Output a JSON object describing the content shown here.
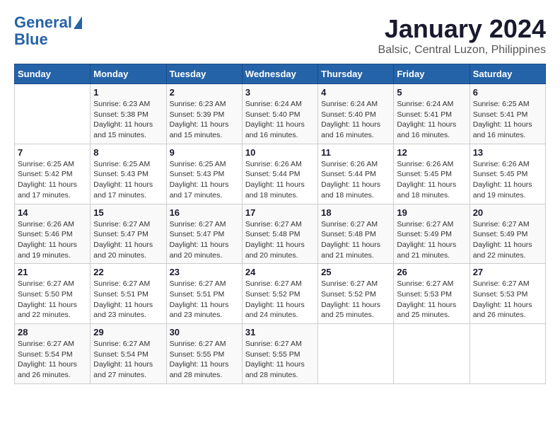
{
  "logo": {
    "line1": "General",
    "line2": "Blue"
  },
  "title": "January 2024",
  "subtitle": "Balsic, Central Luzon, Philippines",
  "weekdays": [
    "Sunday",
    "Monday",
    "Tuesday",
    "Wednesday",
    "Thursday",
    "Friday",
    "Saturday"
  ],
  "weeks": [
    [
      {
        "day": "",
        "info": ""
      },
      {
        "day": "1",
        "info": "Sunrise: 6:23 AM\nSunset: 5:38 PM\nDaylight: 11 hours and 15 minutes."
      },
      {
        "day": "2",
        "info": "Sunrise: 6:23 AM\nSunset: 5:39 PM\nDaylight: 11 hours and 15 minutes."
      },
      {
        "day": "3",
        "info": "Sunrise: 6:24 AM\nSunset: 5:40 PM\nDaylight: 11 hours and 16 minutes."
      },
      {
        "day": "4",
        "info": "Sunrise: 6:24 AM\nSunset: 5:40 PM\nDaylight: 11 hours and 16 minutes."
      },
      {
        "day": "5",
        "info": "Sunrise: 6:24 AM\nSunset: 5:41 PM\nDaylight: 11 hours and 16 minutes."
      },
      {
        "day": "6",
        "info": "Sunrise: 6:25 AM\nSunset: 5:41 PM\nDaylight: 11 hours and 16 minutes."
      }
    ],
    [
      {
        "day": "7",
        "info": "Sunrise: 6:25 AM\nSunset: 5:42 PM\nDaylight: 11 hours and 17 minutes."
      },
      {
        "day": "8",
        "info": "Sunrise: 6:25 AM\nSunset: 5:43 PM\nDaylight: 11 hours and 17 minutes."
      },
      {
        "day": "9",
        "info": "Sunrise: 6:25 AM\nSunset: 5:43 PM\nDaylight: 11 hours and 17 minutes."
      },
      {
        "day": "10",
        "info": "Sunrise: 6:26 AM\nSunset: 5:44 PM\nDaylight: 11 hours and 18 minutes."
      },
      {
        "day": "11",
        "info": "Sunrise: 6:26 AM\nSunset: 5:44 PM\nDaylight: 11 hours and 18 minutes."
      },
      {
        "day": "12",
        "info": "Sunrise: 6:26 AM\nSunset: 5:45 PM\nDaylight: 11 hours and 18 minutes."
      },
      {
        "day": "13",
        "info": "Sunrise: 6:26 AM\nSunset: 5:45 PM\nDaylight: 11 hours and 19 minutes."
      }
    ],
    [
      {
        "day": "14",
        "info": "Sunrise: 6:26 AM\nSunset: 5:46 PM\nDaylight: 11 hours and 19 minutes."
      },
      {
        "day": "15",
        "info": "Sunrise: 6:27 AM\nSunset: 5:47 PM\nDaylight: 11 hours and 20 minutes."
      },
      {
        "day": "16",
        "info": "Sunrise: 6:27 AM\nSunset: 5:47 PM\nDaylight: 11 hours and 20 minutes."
      },
      {
        "day": "17",
        "info": "Sunrise: 6:27 AM\nSunset: 5:48 PM\nDaylight: 11 hours and 20 minutes."
      },
      {
        "day": "18",
        "info": "Sunrise: 6:27 AM\nSunset: 5:48 PM\nDaylight: 11 hours and 21 minutes."
      },
      {
        "day": "19",
        "info": "Sunrise: 6:27 AM\nSunset: 5:49 PM\nDaylight: 11 hours and 21 minutes."
      },
      {
        "day": "20",
        "info": "Sunrise: 6:27 AM\nSunset: 5:49 PM\nDaylight: 11 hours and 22 minutes."
      }
    ],
    [
      {
        "day": "21",
        "info": "Sunrise: 6:27 AM\nSunset: 5:50 PM\nDaylight: 11 hours and 22 minutes."
      },
      {
        "day": "22",
        "info": "Sunrise: 6:27 AM\nSunset: 5:51 PM\nDaylight: 11 hours and 23 minutes."
      },
      {
        "day": "23",
        "info": "Sunrise: 6:27 AM\nSunset: 5:51 PM\nDaylight: 11 hours and 23 minutes."
      },
      {
        "day": "24",
        "info": "Sunrise: 6:27 AM\nSunset: 5:52 PM\nDaylight: 11 hours and 24 minutes."
      },
      {
        "day": "25",
        "info": "Sunrise: 6:27 AM\nSunset: 5:52 PM\nDaylight: 11 hours and 25 minutes."
      },
      {
        "day": "26",
        "info": "Sunrise: 6:27 AM\nSunset: 5:53 PM\nDaylight: 11 hours and 25 minutes."
      },
      {
        "day": "27",
        "info": "Sunrise: 6:27 AM\nSunset: 5:53 PM\nDaylight: 11 hours and 26 minutes."
      }
    ],
    [
      {
        "day": "28",
        "info": "Sunrise: 6:27 AM\nSunset: 5:54 PM\nDaylight: 11 hours and 26 minutes."
      },
      {
        "day": "29",
        "info": "Sunrise: 6:27 AM\nSunset: 5:54 PM\nDaylight: 11 hours and 27 minutes."
      },
      {
        "day": "30",
        "info": "Sunrise: 6:27 AM\nSunset: 5:55 PM\nDaylight: 11 hours and 28 minutes."
      },
      {
        "day": "31",
        "info": "Sunrise: 6:27 AM\nSunset: 5:55 PM\nDaylight: 11 hours and 28 minutes."
      },
      {
        "day": "",
        "info": ""
      },
      {
        "day": "",
        "info": ""
      },
      {
        "day": "",
        "info": ""
      }
    ]
  ]
}
